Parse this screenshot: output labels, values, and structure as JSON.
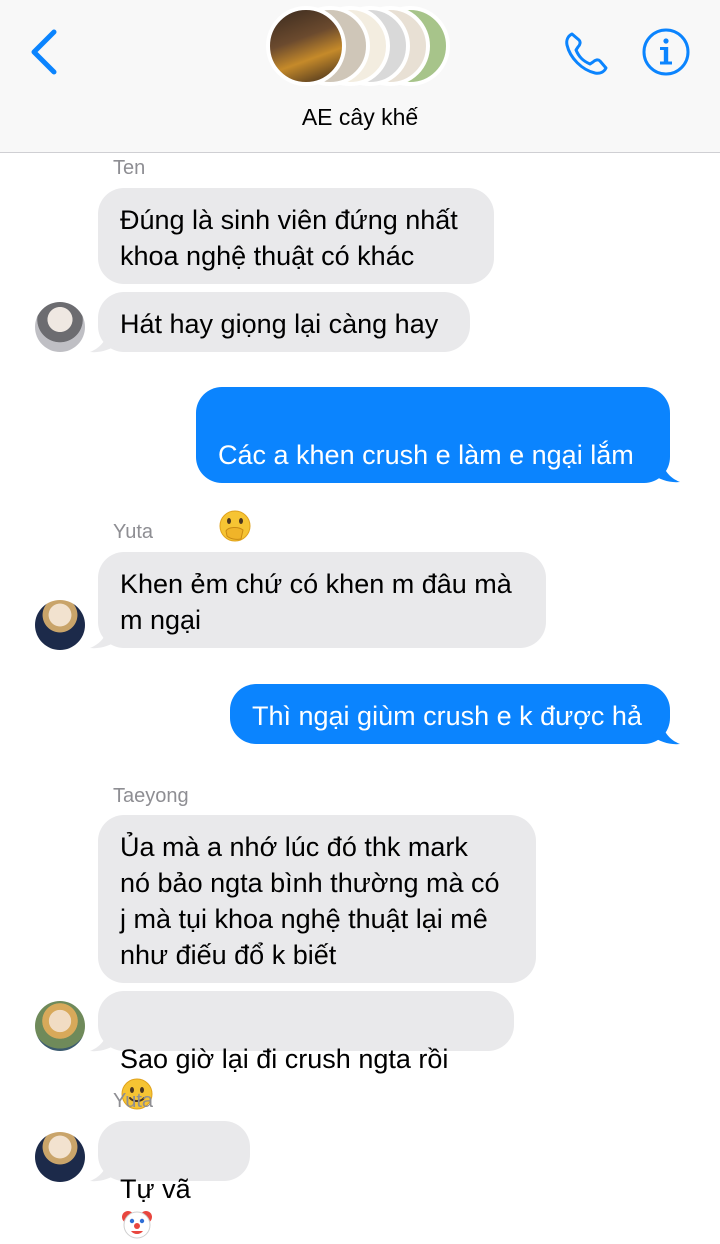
{
  "header": {
    "group_name": "AE cây khế",
    "back_icon": "chevron-left-icon",
    "call_icon": "phone-icon",
    "info_icon": "info-icon",
    "accent": "#0b84fe"
  },
  "messages": [
    {
      "sender": "Ten",
      "lines": [
        "Đúng là sinh viên đứng nhất\nkhoa nghệ thuật có khác",
        "Hát hay giọng lại càng hay"
      ]
    },
    {
      "outgoing": "Các a khen crush e làm e ngại lắm",
      "emoji": "face-with-hand-over-mouth"
    },
    {
      "sender": "Yuta",
      "text": "Khen ẻm chứ có khen m đâu mà\nm ngại"
    },
    {
      "outgoing": "Thì ngại giùm crush e k được hả"
    },
    {
      "sender": "Taeyong",
      "lines": [
        "Ủa mà a nhớ lúc đó thk mark\nnó bảo ngta bình thường mà có\nj mà tụi khoa nghệ thuật lại mê\nnhư điếu đổ k biết",
        "Sao giờ lại đi crush ngta rồi"
      ],
      "emoji": "slightly-smiling-face"
    },
    {
      "sender": "Yuta",
      "text": "Tự vã",
      "emoji": "clown-face"
    }
  ],
  "colors": {
    "incoming_bubble": "#e9e9eb",
    "outgoing_bubble": "#0b84fe",
    "sender_label": "#8e8e93"
  }
}
